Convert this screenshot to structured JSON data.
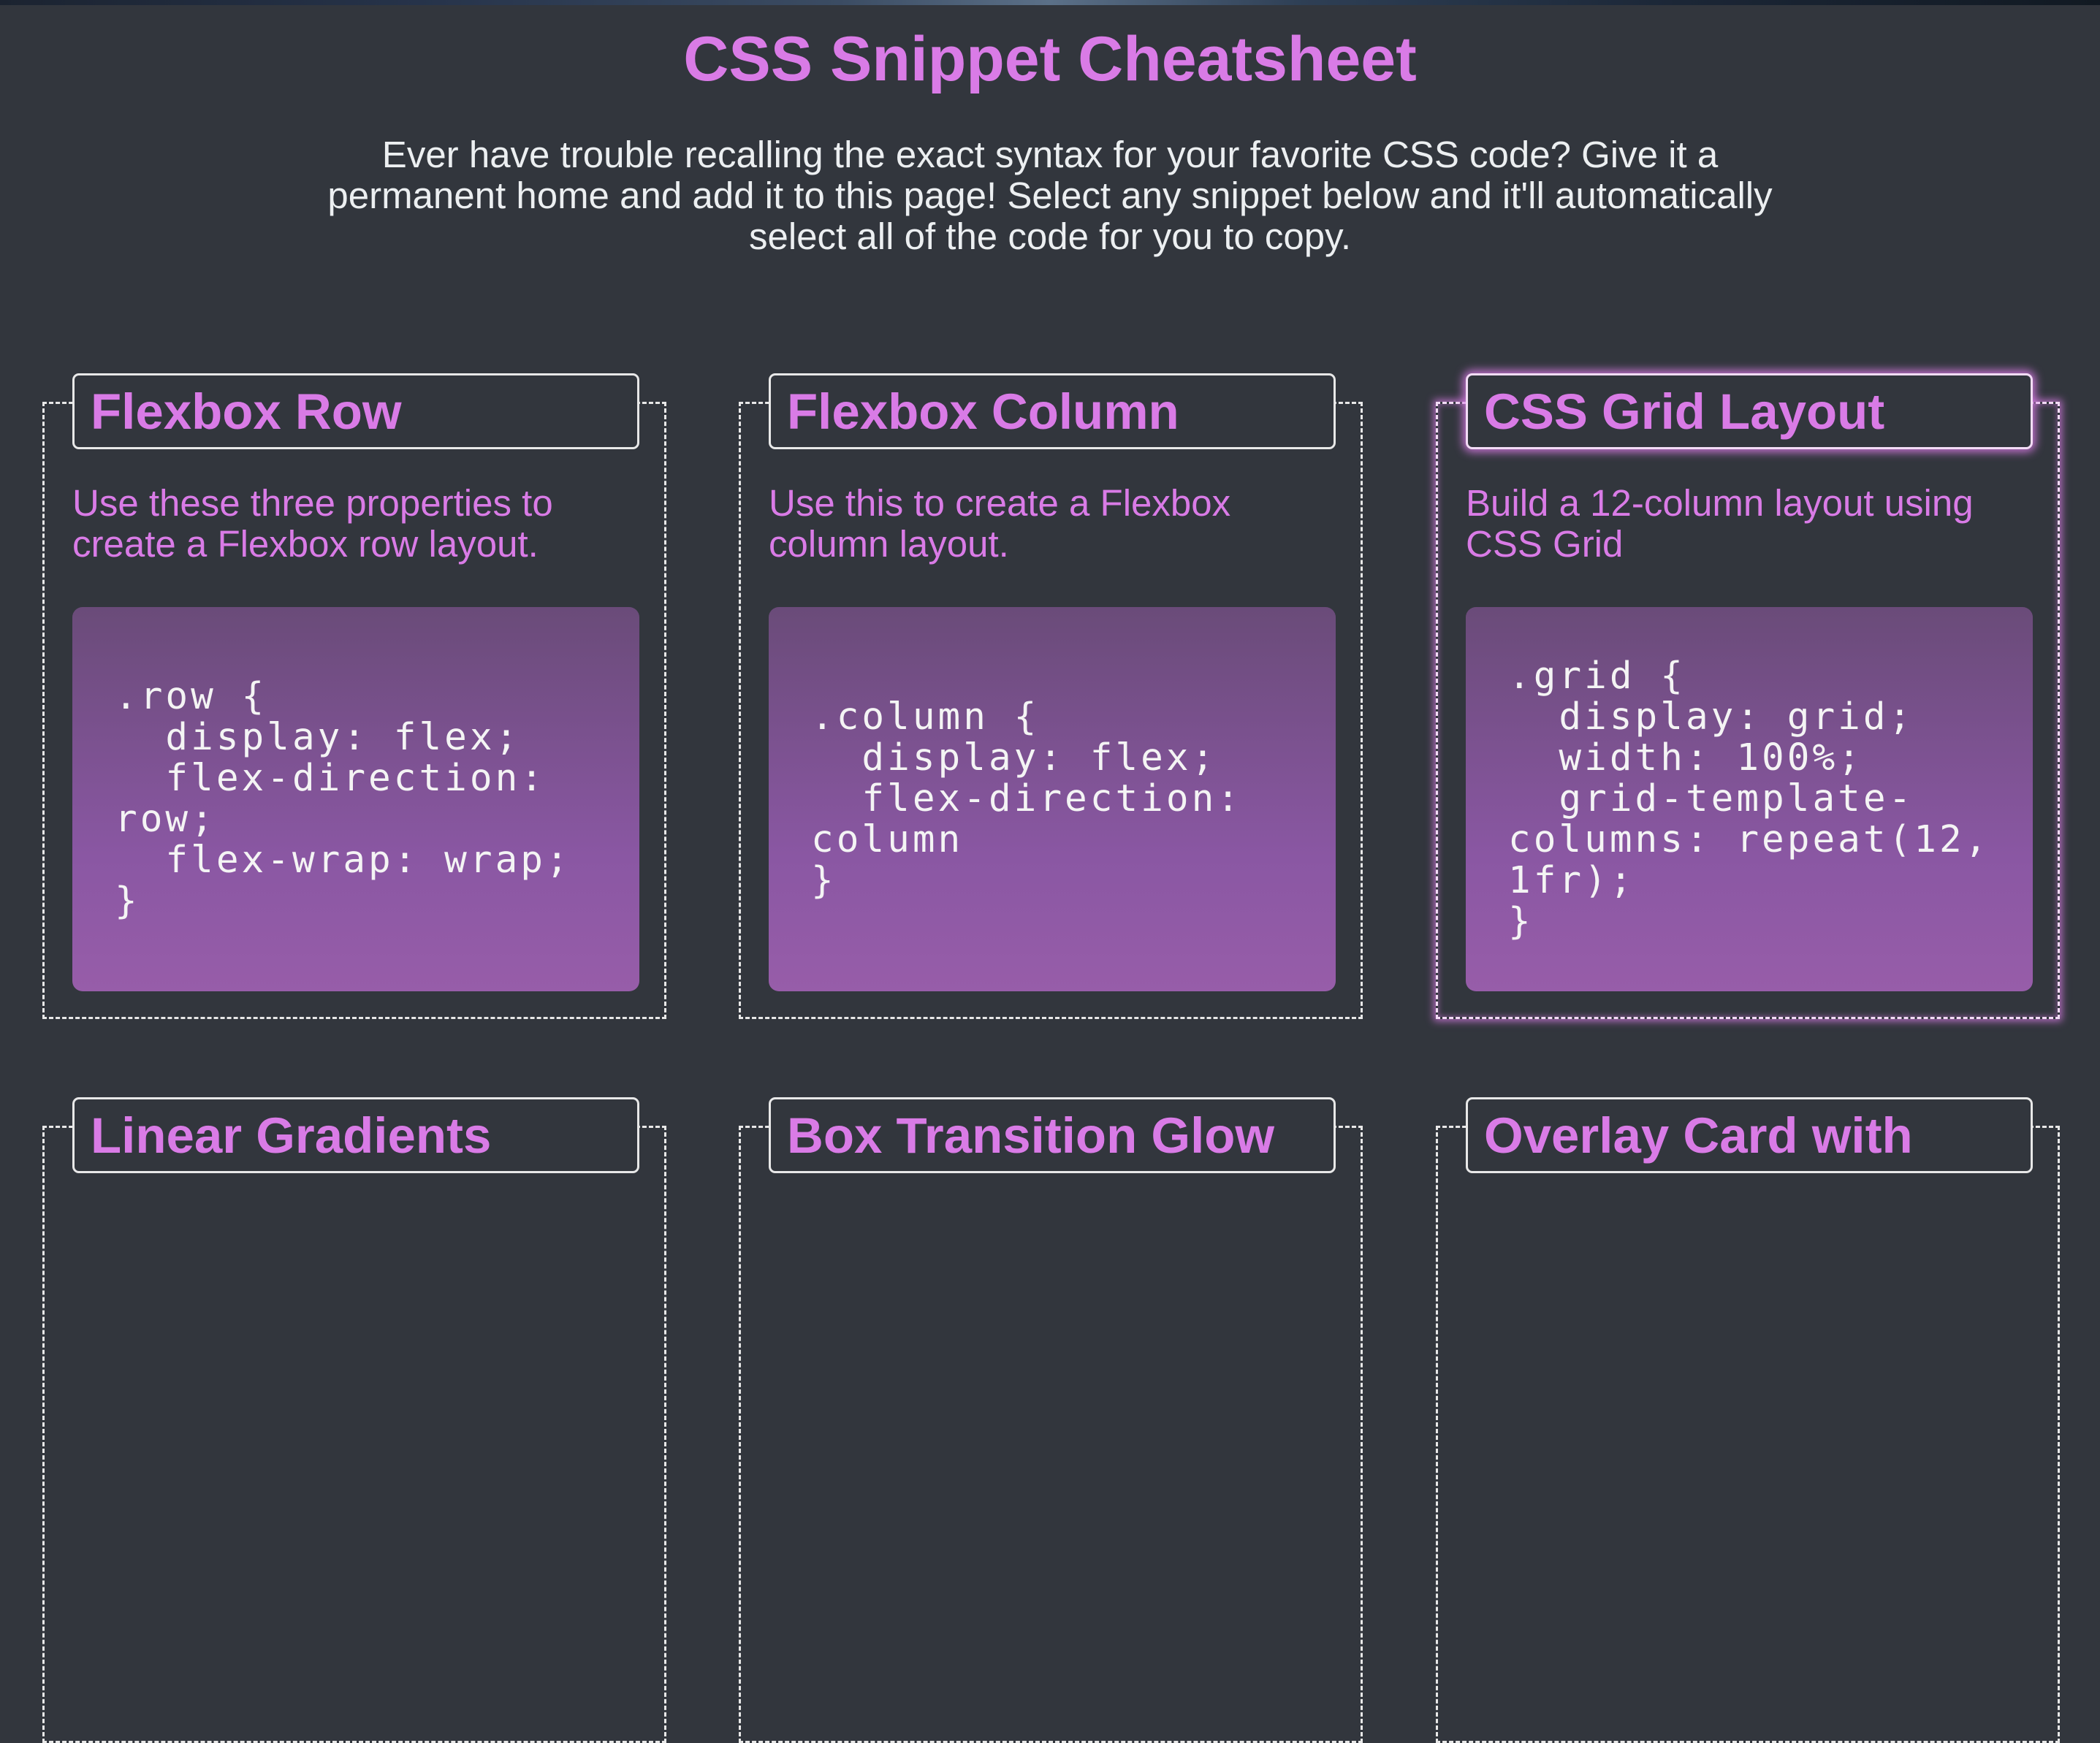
{
  "header": {
    "title": "CSS Snippet Cheatsheet",
    "subtitle": "Ever have trouble recalling the exact syntax for your favorite CSS code? Give it a permanent home and add it to this page! Select any snippet below and it'll automatically select all of the code for you to copy."
  },
  "cards": [
    {
      "title": "Flexbox Row",
      "description": "Use these three properties to create a Flexbox row layout.",
      "code": ".row {\n  display: flex;\n  flex-direction: row;\n  flex-wrap: wrap;\n}"
    },
    {
      "title": "Flexbox Column",
      "description": "Use this to create a Flexbox column layout.",
      "code": ".column {\n  display: flex;\n  flex-direction: column\n}"
    },
    {
      "title": "CSS Grid Layout",
      "description": "Build a 12-column layout using CSS Grid",
      "code": ".grid {\n  display: grid;\n  width: 100%;\n  grid-template-columns: repeat(12, 1fr);\n}"
    },
    {
      "title": "Linear Gradients"
    },
    {
      "title": "Box Transition Glow"
    },
    {
      "title": "Overlay Card with"
    }
  ],
  "colors": {
    "background": "#32363d",
    "accent": "#d97be6",
    "code_bg_top": "#6a4b79",
    "code_bg_bottom": "#975da9"
  }
}
